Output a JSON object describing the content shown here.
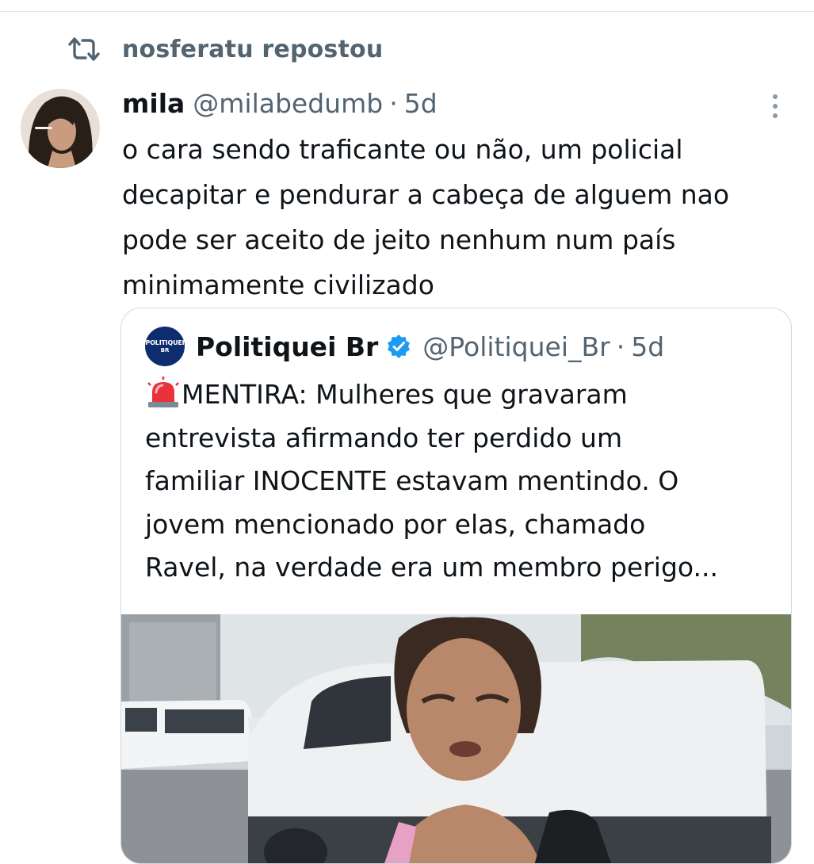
{
  "repost": {
    "icon": "repost-icon",
    "label": "nosferatu repostou"
  },
  "tweet": {
    "display_name": "mila",
    "handle": "@milabedumb",
    "separator": "·",
    "time": "5d",
    "text": "o cara sendo traficante ou não, um policial\ndecapitar e pendurar a cabeça de alguem nao\npode ser aceito de jeito nenhum num país\nminimamente civilizado",
    "more_icon": "more-vertical-icon"
  },
  "quote": {
    "avatar_line1": "POLITIQUEI",
    "avatar_line2": "BR",
    "display_name": "Politiquei Br",
    "verified_icon": "verified-badge-icon",
    "handle": "@Politiquei_Br",
    "separator": "·",
    "time": "5d",
    "emoji_icon": "siren-icon",
    "text": "MENTIRA: Mulheres que gravaram\nentrevista afirmando ter perdido um\nfamiliar INOCENTE estavam mentindo. O\njovem mencionado por elas, chamado\nRavel, na verdade era um membro perigo..."
  },
  "colors": {
    "text_primary": "#0f1419",
    "text_secondary": "#536471",
    "border": "#cfd9de",
    "verified_blue": "#1d9bf0"
  }
}
